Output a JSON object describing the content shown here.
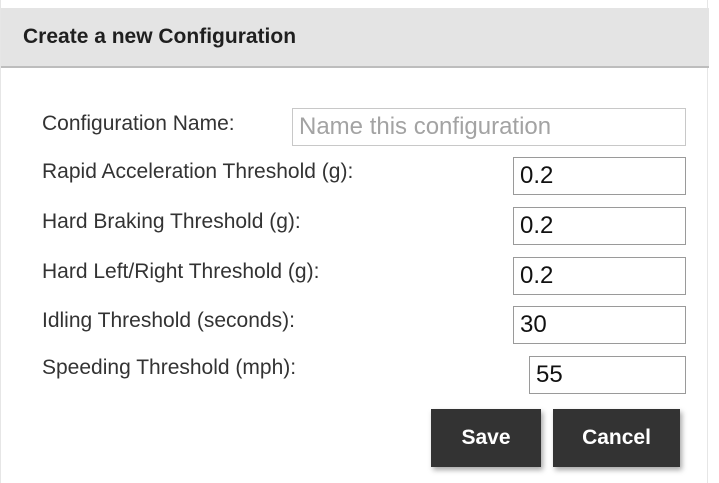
{
  "dialog": {
    "title": "Create a new Configuration",
    "fields": [
      {
        "label": "Configuration Name:",
        "value": "",
        "placeholder": "Name this configuration"
      },
      {
        "label": "Rapid Acceleration Threshold (g):",
        "value": "0.2",
        "placeholder": ""
      },
      {
        "label": "Hard Braking Threshold (g):",
        "value": "0.2",
        "placeholder": ""
      },
      {
        "label": "Hard Left/Right Threshold (g):",
        "value": "0.2",
        "placeholder": ""
      },
      {
        "label": "Idling Threshold (seconds):",
        "value": "30",
        "placeholder": ""
      },
      {
        "label": "Speeding Threshold (mph):",
        "value": "55",
        "placeholder": ""
      }
    ],
    "buttons": {
      "save_label": "Save",
      "cancel_label": "Cancel"
    }
  },
  "colors": {
    "header_bg": "#e4e4e4",
    "button_bg": "#333333",
    "button_text": "#ffffff",
    "placeholder": "#a3a3a3"
  }
}
